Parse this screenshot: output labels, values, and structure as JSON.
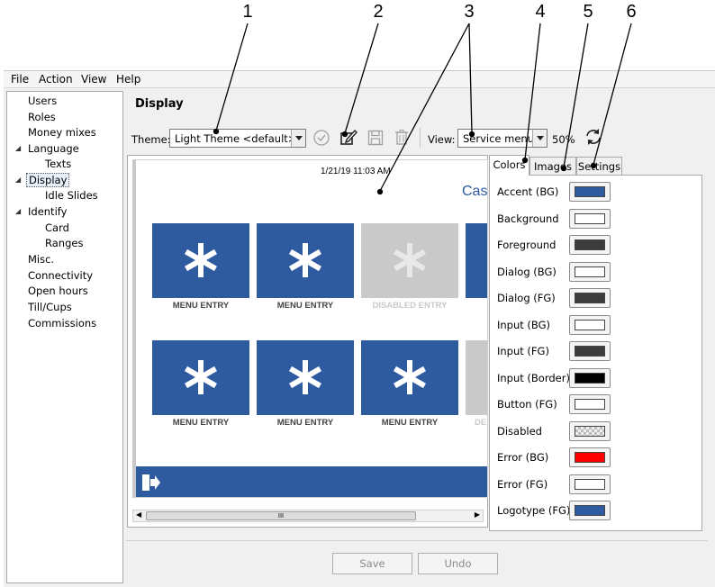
{
  "callouts": [
    "1",
    "2",
    "3",
    "4",
    "5",
    "6"
  ],
  "menu": [
    "File",
    "Action",
    "View",
    "Help"
  ],
  "sidebar": {
    "items": [
      {
        "label": "Users"
      },
      {
        "label": "Roles"
      },
      {
        "label": "Money mixes"
      },
      {
        "label": "Language",
        "expanded": true
      },
      {
        "label": "Texts"
      },
      {
        "label": "Display",
        "expanded": true,
        "selected": true
      },
      {
        "label": "Idle Slides"
      },
      {
        "label": "Identify",
        "expanded": true
      },
      {
        "label": "Card"
      },
      {
        "label": "Ranges"
      },
      {
        "label": "Misc."
      },
      {
        "label": "Connectivity"
      },
      {
        "label": "Open hours"
      },
      {
        "label": "Till/Cups"
      },
      {
        "label": "Commissions"
      }
    ]
  },
  "main": {
    "title": "Display",
    "theme_label": "Theme:",
    "theme_value": "Light Theme <default>",
    "view_label": "View:",
    "view_value": "Service menu",
    "zoom": "50%",
    "icons": [
      "check-circle-icon",
      "edit-icon",
      "save-icon",
      "trash-icon",
      "refresh-icon"
    ]
  },
  "preview": {
    "datetime": "1/21/19 11:03 AM",
    "partial_title": "Cash",
    "row1": [
      "MENU ENTRY",
      "MENU ENTRY",
      "DISABLED ENTRY"
    ],
    "row2": [
      "MENU ENTRY",
      "MENU ENTRY",
      "MENU ENTRY",
      "DE"
    ],
    "scroll_grip": "III",
    "accent": "#2e5aa0",
    "disabled_color": "#c9c9c9"
  },
  "tabs": [
    "Colors",
    "Images",
    "Settings"
  ],
  "active_tab": "Colors",
  "colors": [
    {
      "label": "Accent (BG)",
      "color": "#2e5aa0"
    },
    {
      "label": "Background",
      "color": "#ffffff"
    },
    {
      "label": "Foreground",
      "color": "#3c3c3c"
    },
    {
      "label": "Dialog (BG)",
      "color": "#ffffff"
    },
    {
      "label": "Dialog (FG)",
      "color": "#3c3c3c"
    },
    {
      "label": "Input (BG)",
      "color": "#ffffff"
    },
    {
      "label": "Input (FG)",
      "color": "#3c3c3c"
    },
    {
      "label": "Input (Border)",
      "color": "#000000"
    },
    {
      "label": "Button (FG)",
      "color": "#ffffff"
    },
    {
      "label": "Disabled",
      "color": "checker"
    },
    {
      "label": "Error (BG)",
      "color": "#ff0000"
    },
    {
      "label": "Error (FG)",
      "color": "#ffffff"
    },
    {
      "label": "Logotype (FG)",
      "color": "#2e5aa0"
    }
  ],
  "buttons": {
    "save": "Save",
    "undo": "Undo"
  }
}
